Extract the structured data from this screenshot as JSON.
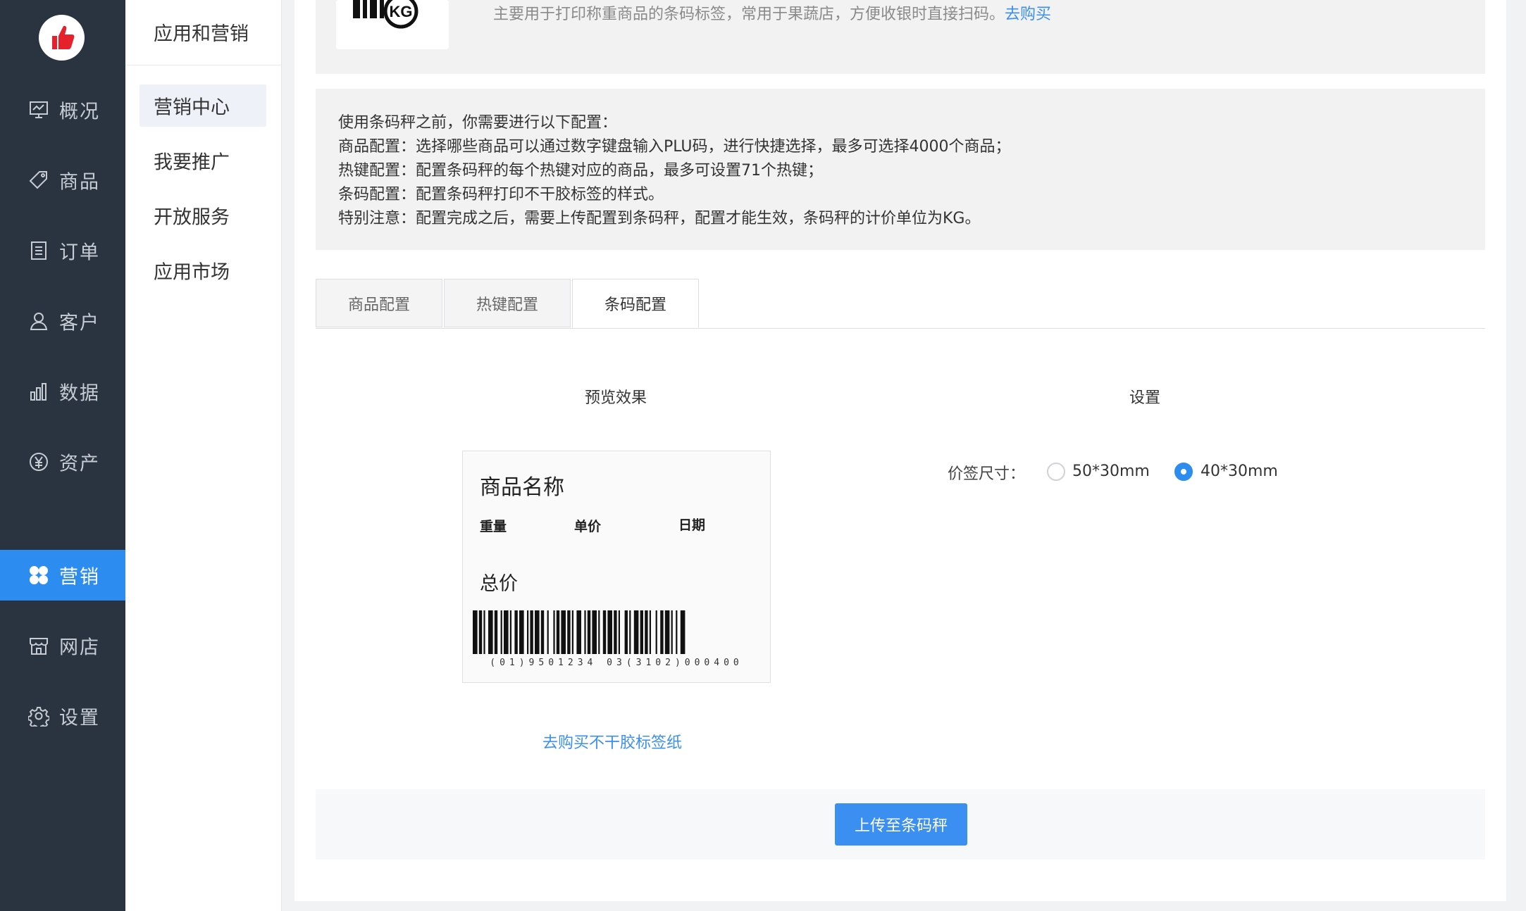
{
  "sidebar": {
    "items": [
      {
        "label": "概况",
        "icon": "overview-icon"
      },
      {
        "label": "商品",
        "icon": "tag-icon"
      },
      {
        "label": "订单",
        "icon": "order-icon"
      },
      {
        "label": "客户",
        "icon": "user-icon"
      },
      {
        "label": "数据",
        "icon": "chart-icon"
      },
      {
        "label": "资产",
        "icon": "yen-icon"
      },
      {
        "label": "营销",
        "icon": "marketing-icon",
        "active": true
      },
      {
        "label": "网店",
        "icon": "store-icon"
      },
      {
        "label": "设置",
        "icon": "gear-icon"
      }
    ],
    "active_color": "#2d8cf0"
  },
  "subnav": {
    "title": "应用和营销",
    "items": [
      {
        "label": "营销中心",
        "active": true
      },
      {
        "label": "我要推广"
      },
      {
        "label": "开放服务"
      },
      {
        "label": "应用市场"
      }
    ]
  },
  "product": {
    "description": "主要用于打印称重商品的条码标签，常用于果蔬店，方便收银时直接扫码。",
    "buy_link": "去购买",
    "image_icon": "kg-scale-icon"
  },
  "info": {
    "lines": [
      "使用条码秤之前，你需要进行以下配置：",
      "商品配置：选择哪些商品可以通过数字键盘输入PLU码，进行快捷选择，最多可选择4000个商品；",
      "热键配置：配置条码秤的每个热键对应的商品，最多可设置71个热键；",
      "条码配置：配置条码秤打印不干胶标签的样式。",
      "特别注意：配置完成之后，需要上传配置到条码秤，配置才能生效，条码秤的计价单位为KG。"
    ]
  },
  "tabs": [
    {
      "label": "商品配置"
    },
    {
      "label": "热键配置"
    },
    {
      "label": "条码配置",
      "active": true
    }
  ],
  "preview": {
    "heading": "预览效果",
    "label": {
      "name": "商品名称",
      "weight": "重量",
      "unit_price": "单价",
      "date": "日期",
      "total": "总价",
      "barcode_text": "(01)9501234 03(3102)000400"
    },
    "buy_paper_link": "去购买不干胶标签纸"
  },
  "settings": {
    "heading": "设置",
    "size_label": "价签尺寸：",
    "options": [
      {
        "label": "50*30mm",
        "checked": false
      },
      {
        "label": "40*30mm",
        "checked": true
      }
    ]
  },
  "actions": {
    "upload_label": "上传至条码秤"
  }
}
